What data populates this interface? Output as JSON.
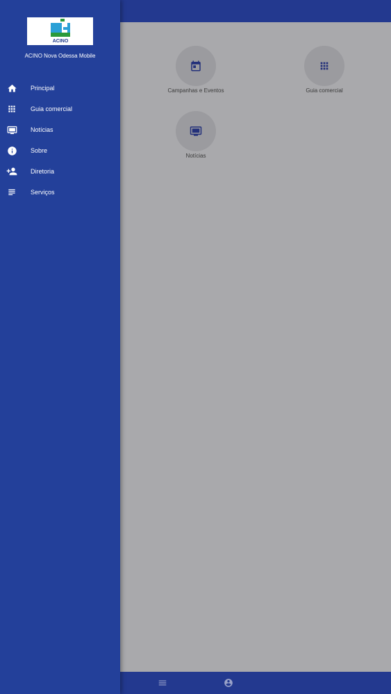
{
  "app": {
    "title": "ACINO Nova Odessa Mobile",
    "logo_text": "ACINO"
  },
  "drawer": {
    "items": [
      {
        "label": "Principal",
        "icon": "home-icon"
      },
      {
        "label": "Guia comercial",
        "icon": "grid-icon"
      },
      {
        "label": "Notícias",
        "icon": "tv-icon"
      },
      {
        "label": "Sobre",
        "icon": "info-icon"
      },
      {
        "label": "Diretoria",
        "icon": "person-add-icon"
      },
      {
        "label": "Serviços",
        "icon": "notes-icon"
      }
    ]
  },
  "main": {
    "tiles": [
      {
        "label": "Campanhas e Eventos",
        "icon": "calendar-icon"
      },
      {
        "label": "Guia comercial",
        "icon": "grid-icon"
      },
      {
        "label": "Notícias",
        "icon": "tv-icon"
      }
    ]
  },
  "bottom_nav": {
    "items": [
      {
        "icon": "menu-icon"
      },
      {
        "icon": "account-circle-icon"
      }
    ]
  },
  "colors": {
    "primary": "#23398f",
    "drawer": "#23409a",
    "scrim_background": "#a9a9ac",
    "icon_dark": "#23307a"
  }
}
